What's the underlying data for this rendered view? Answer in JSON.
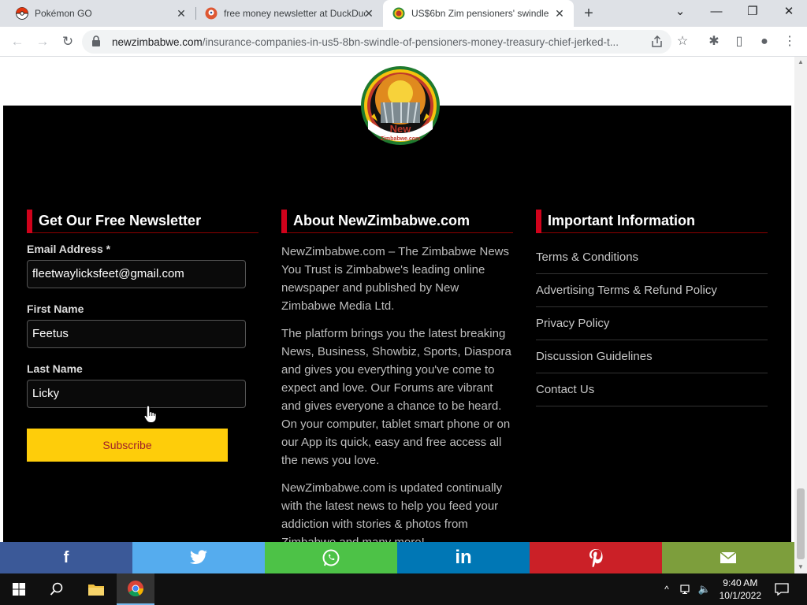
{
  "browser": {
    "tabs": [
      {
        "title": "Pokémon GO",
        "icon": "pokeball-icon"
      },
      {
        "title": "free money newsletter at DuckDuckGo",
        "icon": "duckduckgo-icon"
      },
      {
        "title": "US$6bn Zim pensioners' swindle",
        "icon": "newzimbabwe-icon"
      }
    ],
    "url_host": "newzimbabwe.com",
    "url_path": "/insurance-companies-in-us5-8bn-swindle-of-pensioners-money-treasury-chief-jerked-t..."
  },
  "newsletter": {
    "heading": "Get Our Free Newsletter",
    "email_label": "Email Address *",
    "email_value": "fleetwaylicksfeet@gmail.com",
    "first_label": "First Name",
    "first_value": "Feetus",
    "last_label": "Last Name",
    "last_value": "Licky",
    "subscribe_label": "Subscribe"
  },
  "about": {
    "heading": "About NewZimbabwe.com",
    "p1": "NewZimbabwe.com – The Zimbabwe News You Trust is Zimbabwe's leading online newspaper and published by New Zimbabwe Media Ltd.",
    "p2": "The platform brings you the latest breaking News, Business, Showbiz, Sports, Diaspora and gives you everything you've come to expect and love. Our Forums are vibrant and gives everyone a chance to be heard. On your computer, tablet smart phone or on our App its quick, easy and free access all the news you love.",
    "p3": "NewZimbabwe.com is updated continually with the latest news to help you feed your addiction with stories & photos from Zimbabwe and many more!"
  },
  "info": {
    "heading": "Important Information",
    "links": [
      "Terms & Conditions",
      "Advertising Terms & Refund Policy",
      "Privacy Policy",
      "Discussion Guidelines",
      "Contact Us"
    ]
  },
  "logo": {
    "text_top": "New",
    "text_bottom": "Zimbabwe.com"
  },
  "share": [
    {
      "name": "facebook",
      "glyph": "f",
      "color": "#3b5998"
    },
    {
      "name": "twitter",
      "glyph": "🐦",
      "color": "#55acee"
    },
    {
      "name": "whatsapp",
      "glyph": "✆",
      "color": "#4dc247"
    },
    {
      "name": "linkedin",
      "glyph": "in",
      "color": "#0077b5"
    },
    {
      "name": "pinterest",
      "glyph": "P",
      "color": "#cb2027"
    },
    {
      "name": "email",
      "glyph": "✉",
      "color": "#7d9e3c"
    }
  ],
  "taskbar": {
    "time": "9:40 AM",
    "date": "10/1/2022"
  },
  "colors": {
    "accent_red": "#d0021b",
    "subscribe_bg": "#fecd0a",
    "footer_bg": "#000000"
  }
}
